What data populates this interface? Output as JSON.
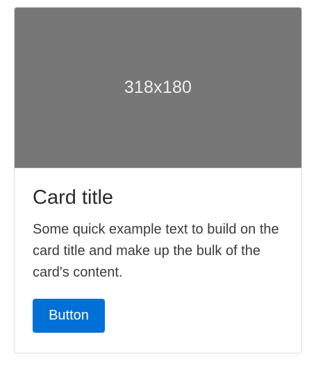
{
  "card": {
    "image_placeholder": "318x180",
    "title": "Card title",
    "text": "Some quick example text to build on the card title and make up the bulk of the card's content.",
    "button_label": "Button"
  },
  "colors": {
    "image_bg": "#777777",
    "button_bg": "#0070d9",
    "button_text": "#ffffff"
  }
}
